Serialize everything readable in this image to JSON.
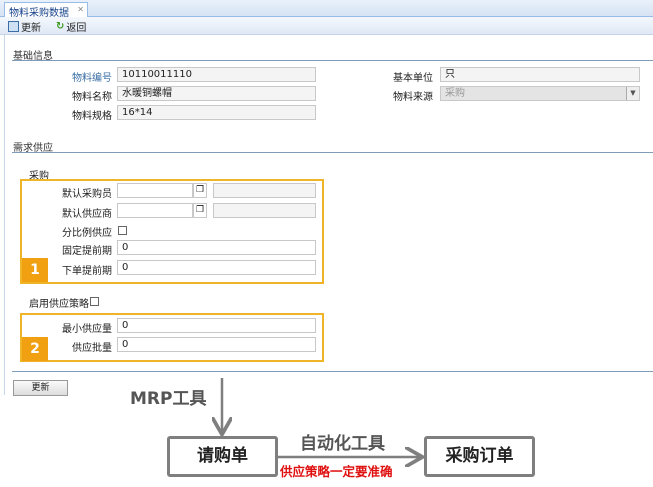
{
  "tab": {
    "title": "物料采购数据",
    "close_icon": "close-icon"
  },
  "toolbar": {
    "update": "更新",
    "back": "返回"
  },
  "basic": {
    "title": "基础信息",
    "fields": [
      {
        "label": "物料编号",
        "value": "10110011110"
      },
      {
        "label": "物料名称",
        "value": "水暖铜螺帽"
      },
      {
        "label": "物料规格",
        "value": "16*14"
      }
    ],
    "right": [
      {
        "label": "基本单位",
        "value": "只"
      },
      {
        "label": "物料来源",
        "value": "采购"
      }
    ]
  },
  "supply": {
    "title": "需求供应",
    "purchase_title": "采购",
    "buyer_label": "默认采购员",
    "vendor_label": "默认供应商",
    "ratio_label": "分比例供应",
    "fixed_lead_label": "固定提前期",
    "fixed_lead_value": "0",
    "order_lead_label": "下单提前期",
    "order_lead_value": "0",
    "strategy_label": "启用供应策略",
    "min_qty_label": "最小供应量",
    "min_qty_value": "0",
    "batch_label": "供应批量",
    "batch_value": "0",
    "badge1": "1",
    "badge2": "2",
    "accent": "#f0b429"
  },
  "footer": {
    "update": "更新"
  },
  "diagram": {
    "mrp": "MRP工具",
    "req": "请购单",
    "auto": "自动化工具",
    "po": "采购订单",
    "note": "供应策略一定要准确",
    "note_color": "#e01010"
  }
}
